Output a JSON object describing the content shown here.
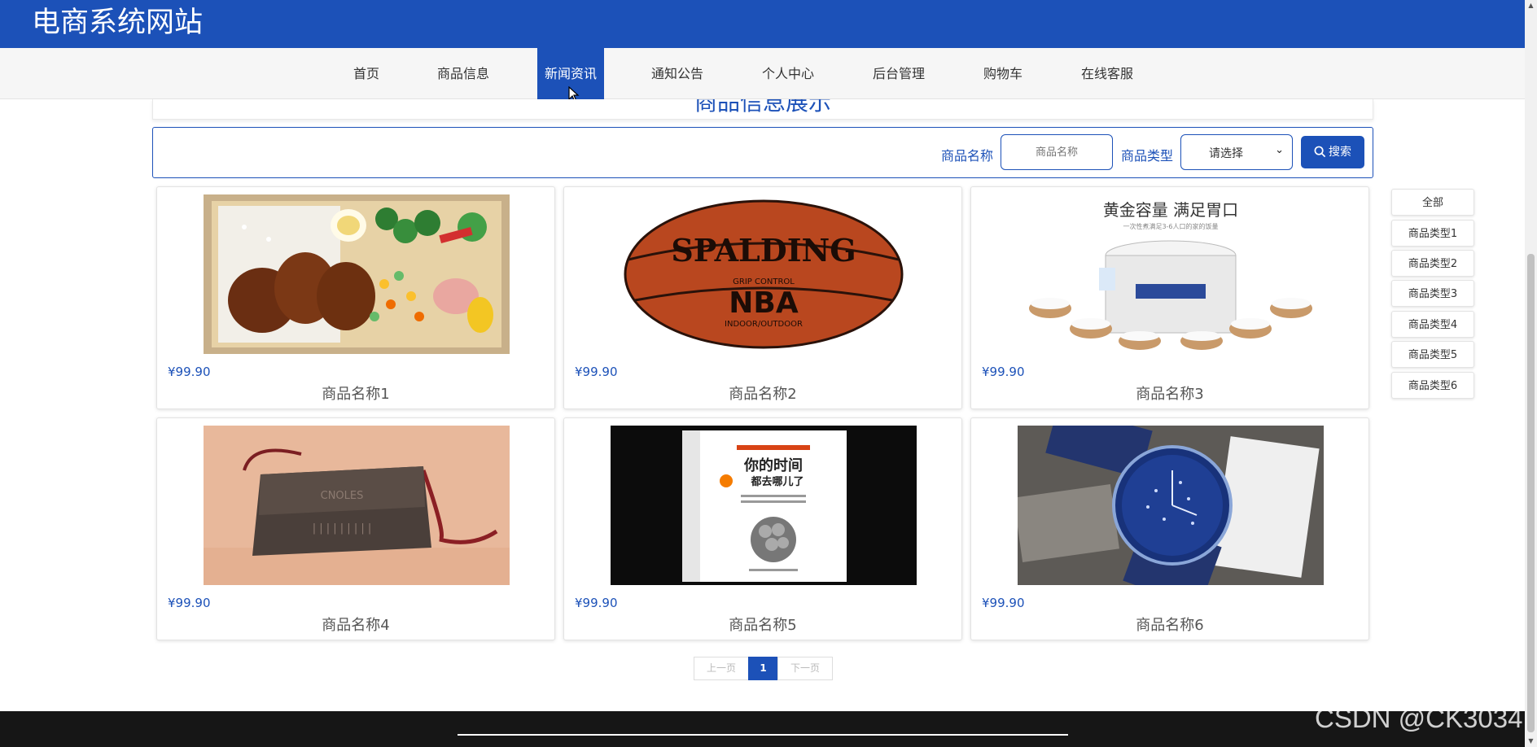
{
  "header": {
    "site_title": "电商系统网站"
  },
  "nav": [
    {
      "label": "首页"
    },
    {
      "label": "商品信息"
    },
    {
      "label": "新闻资讯",
      "active": true
    },
    {
      "label": "通知公告"
    },
    {
      "label": "个人中心"
    },
    {
      "label": "后台管理"
    },
    {
      "label": "购物车"
    },
    {
      "label": "在线客服"
    }
  ],
  "section_title": "商品信息展示",
  "search": {
    "name_label": "商品名称",
    "name_placeholder": "商品名称",
    "type_label": "商品类型",
    "type_selected": "请选择",
    "button_label": "搜索"
  },
  "products": [
    {
      "price": "¥99.90",
      "name": "商品名称1",
      "image": "food-bento"
    },
    {
      "price": "¥99.90",
      "name": "商品名称2",
      "image": "basketball"
    },
    {
      "price": "¥99.90",
      "name": "商品名称3",
      "image": "rice-cooker"
    },
    {
      "price": "¥99.90",
      "name": "商品名称4",
      "image": "handbag"
    },
    {
      "price": "¥99.90",
      "name": "商品名称5",
      "image": "book"
    },
    {
      "price": "¥99.90",
      "name": "商品名称6",
      "image": "wristwatch"
    }
  ],
  "image_text": {
    "ball_brand": "SPALDING",
    "ball_league": "NBA",
    "ball_grip": "GRIP CONTROL",
    "ball_bottom": "INDOOR/OUTDOOR",
    "cooker_slogan": "黄金容量 满足胃口",
    "cooker_sub": "一次性煮满足3-6人口的家的饭量",
    "book_title_1": "你的时间",
    "book_title_2": "都去哪儿了",
    "bag_logo": "CNOLES"
  },
  "categories": [
    "全部",
    "商品类型1",
    "商品类型2",
    "商品类型3",
    "商品类型4",
    "商品类型5",
    "商品类型6"
  ],
  "pagination": {
    "prev": "上一页",
    "current": "1",
    "next": "下一页"
  },
  "watermark": "CSDN @CK3034",
  "colors": {
    "primary": "#1c51b8",
    "footer": "#161616",
    "nav_bg": "#f6f6f6"
  }
}
